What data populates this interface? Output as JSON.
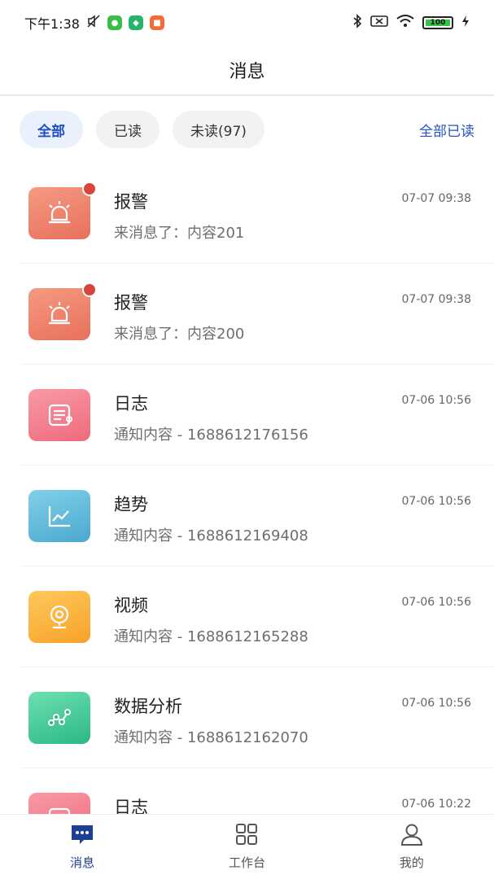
{
  "status_bar": {
    "time": "下午1:38",
    "battery": "100"
  },
  "header": {
    "title": "消息"
  },
  "filters": {
    "tabs": [
      {
        "label": "全部"
      },
      {
        "label": "已读"
      },
      {
        "label": "未读(97)"
      }
    ],
    "mark_all_read": "全部已读"
  },
  "messages": [
    {
      "title": "报警",
      "content": "来消息了：内容201",
      "time": "07-07 09:38",
      "icon": "alarm-icon",
      "unread": true
    },
    {
      "title": "报警",
      "content": "来消息了：内容200",
      "time": "07-07 09:38",
      "icon": "alarm-icon",
      "unread": true
    },
    {
      "title": "日志",
      "content": "通知内容 - 1688612176156",
      "time": "07-06 10:56",
      "icon": "log-icon",
      "unread": false
    },
    {
      "title": "趋势",
      "content": "通知内容 - 1688612169408",
      "time": "07-06 10:56",
      "icon": "trend-chart-icon",
      "unread": false
    },
    {
      "title": "视频",
      "content": "通知内容 - 1688612165288",
      "time": "07-06 10:56",
      "icon": "camera-icon",
      "unread": false
    },
    {
      "title": "数据分析",
      "content": "通知内容 - 1688612162070",
      "time": "07-06 10:56",
      "icon": "data-analysis-icon",
      "unread": false
    },
    {
      "title": "日志",
      "content": "",
      "time": "07-06 10:22",
      "icon": "log-icon",
      "unread": false
    }
  ],
  "tabbar": {
    "items": [
      {
        "label": "消息",
        "icon": "message-icon"
      },
      {
        "label": "工作台",
        "icon": "workbench-icon"
      },
      {
        "label": "我的",
        "icon": "user-icon"
      }
    ]
  },
  "colors": {
    "accent": "#1f4fbf",
    "unread_dot": "#d9443d"
  }
}
